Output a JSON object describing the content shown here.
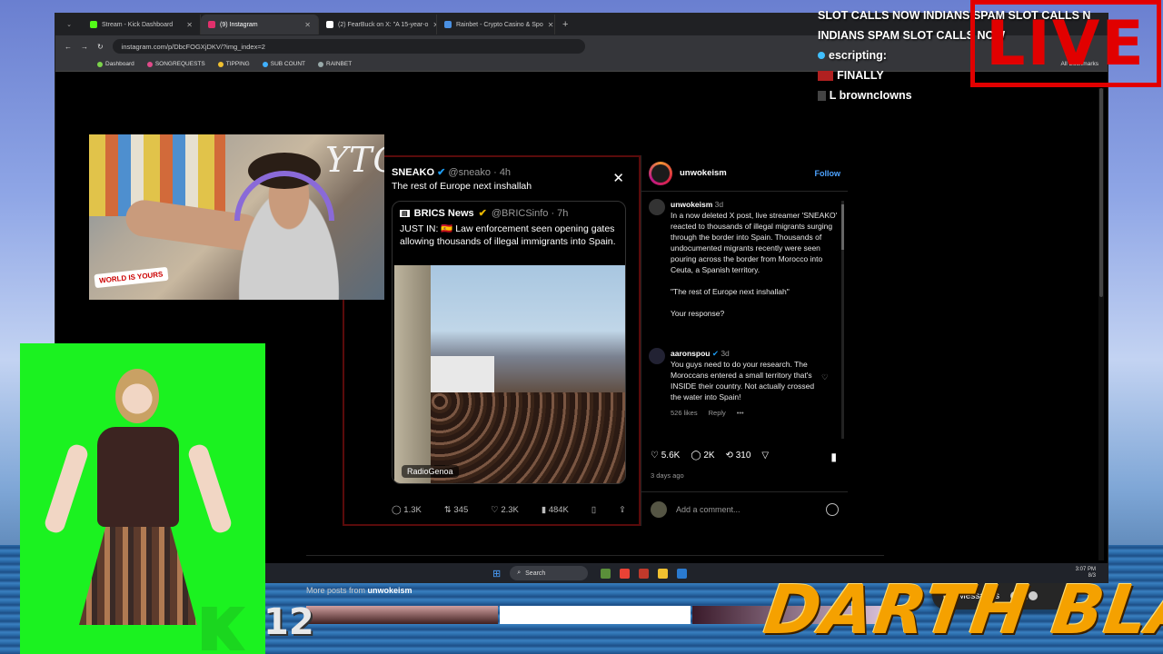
{
  "browser": {
    "tabs": [
      {
        "label": "Stream - Kick Dashboard",
        "color": "#53fc18"
      },
      {
        "label": "(9) Instagram",
        "color": "#e1306c"
      },
      {
        "label": "(2) FearBuck on X: \"A 15-year-o",
        "color": "#ffffff"
      },
      {
        "label": "Rainbet - Crypto Casino & Spo",
        "color": "#4a90e2"
      }
    ],
    "new_tab": "+",
    "url": "instagram.com/p/DbcFOGXjDKV/?img_index=2",
    "bookmarks": [
      "Dashboard",
      "SONGREQUESTS",
      "TIPPING",
      "SUB COUNT",
      "RAINBET"
    ],
    "all_bookmarks": "All Bookmarks"
  },
  "tweet": {
    "author": "SNEAKO",
    "handle": "@sneako · 4h",
    "text": "The rest of Europe next inshallah",
    "quote": {
      "author": "BRICS News",
      "handle": "@BRICSinfo · 7h",
      "text": "JUST IN: 🇪🇸 Law enforcement seen opening gates allowing thousands of illegal immigrants into Spain.",
      "credit": "RadioGenoa"
    },
    "actions": [
      "1.3K",
      "345",
      "2.3K",
      "484K"
    ]
  },
  "post": {
    "account": "unwokeism",
    "follow": "Follow",
    "caption_user": "unwokeism",
    "caption_time": "3d",
    "caption_text": "In a now deleted X post, live streamer 'SNEAKO' reacted to thousands of illegal migrants surging through the border into Spain. Thousands of undocumented migrants recently were seen pouring across the border from Morocco into Ceuta, a Spanish territory.",
    "caption_quote": "\"The rest of Europe next inshallah\"",
    "caption_ask": "Your response?",
    "comment_user": "aaronspou",
    "comment_time": "3d",
    "comment_text": "You guys need to do your research. The Moroccans entered a small territory that's INSIDE their country. Not actually crossed the water into Spain!",
    "comment_likes": "526 likes",
    "comment_reply": "Reply",
    "likes": "5.6K",
    "comments": "2K",
    "shares": "310",
    "date": "3 days ago",
    "add_comment": "Add a comment..."
  },
  "more_posts": {
    "prefix": "More posts from",
    "user": "unwokeism"
  },
  "messages": "Messages",
  "taskbar": {
    "search": "Search",
    "time": "3:07 PM",
    "date": "8/3"
  },
  "overlay": {
    "chat": [
      "SLOT CALLS NOW INDIANS SPAM SLOT CALLS NOW",
      "INDIANS SPAM SLOT CALLS NOW",
      "escripting:",
      "FINALLY",
      "L browncIowns"
    ],
    "live": "LIVE",
    "ytg": "YTG",
    "kick_count": "12",
    "darth": "DARTH BLAZE"
  }
}
